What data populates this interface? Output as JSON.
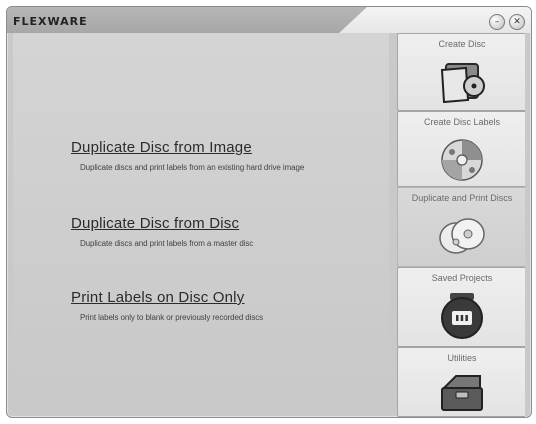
{
  "app": {
    "title": "FLEXWARE"
  },
  "window_controls": {
    "minimize_glyph": "–",
    "close_glyph": "✕"
  },
  "options": [
    {
      "title": "Duplicate Disc from Image",
      "description": "Duplicate discs and print labels from an existing hard drive image"
    },
    {
      "title": "Duplicate Disc from Disc",
      "description": "Duplicate discs and print labels from a master disc"
    },
    {
      "title": "Print Labels on Disc Only",
      "description": "Print labels only to blank or previously recorded discs"
    }
  ],
  "sidebar": {
    "active_index": 2,
    "items": [
      {
        "label": "Create Disc",
        "icon": "disc-folder-icon"
      },
      {
        "label": "Create Disc Labels",
        "icon": "disc-label-icon"
      },
      {
        "label": "Duplicate and Print Discs",
        "icon": "disc-stack-icon"
      },
      {
        "label": "Saved Projects",
        "icon": "disc-case-icon"
      },
      {
        "label": "Utilities",
        "icon": "toolbox-icon"
      }
    ]
  }
}
